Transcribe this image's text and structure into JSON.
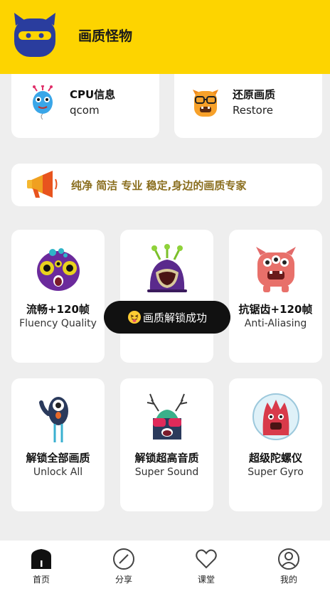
{
  "header": {
    "title": "画质怪物",
    "logo_icon": "monster-logo-icon"
  },
  "info_cards": [
    {
      "title": "CPU信息",
      "value": "qcom",
      "icon": "balloon-monster-icon"
    },
    {
      "title": "还原画质",
      "value": "Restore",
      "icon": "glasses-monster-icon"
    }
  ],
  "slogan": {
    "text": "纯净 简洁 专业 稳定,身边的画质专家",
    "icon": "megaphone-icon"
  },
  "features": [
    {
      "zh": "流畅+120帧",
      "en": "Fluency Quality",
      "icon": "purple-three-eyed-monster-icon"
    },
    {
      "zh": "",
      "en": "",
      "icon": "antenna-monster-icon"
    },
    {
      "zh": "抗锯齿+120帧",
      "en": "Anti-Aliasing",
      "icon": "red-multi-eyed-monster-icon"
    },
    {
      "zh": "解锁全部画质",
      "en": "Unlock All",
      "icon": "one-eyed-stick-monster-icon"
    },
    {
      "zh": "解锁超高音质",
      "en": "Super Sound",
      "icon": "antler-monster-icon"
    },
    {
      "zh": "超级陀螺仪",
      "en": "Super Gyro",
      "icon": "astronaut-monster-icon"
    }
  ],
  "toast": {
    "text": "画质解锁成功",
    "icon": "tongue-emoji-icon"
  },
  "bottom_nav": [
    {
      "label": "首页",
      "icon": "home-icon"
    },
    {
      "label": "分享",
      "icon": "compass-icon"
    },
    {
      "label": "课堂",
      "icon": "heart-icon"
    },
    {
      "label": "我的",
      "icon": "user-icon"
    }
  ],
  "colors": {
    "header_bg": "#fdd400",
    "page_bg": "#eeeeee",
    "slogan_text": "#8a6e1e",
    "toast_bg": "#111111"
  }
}
